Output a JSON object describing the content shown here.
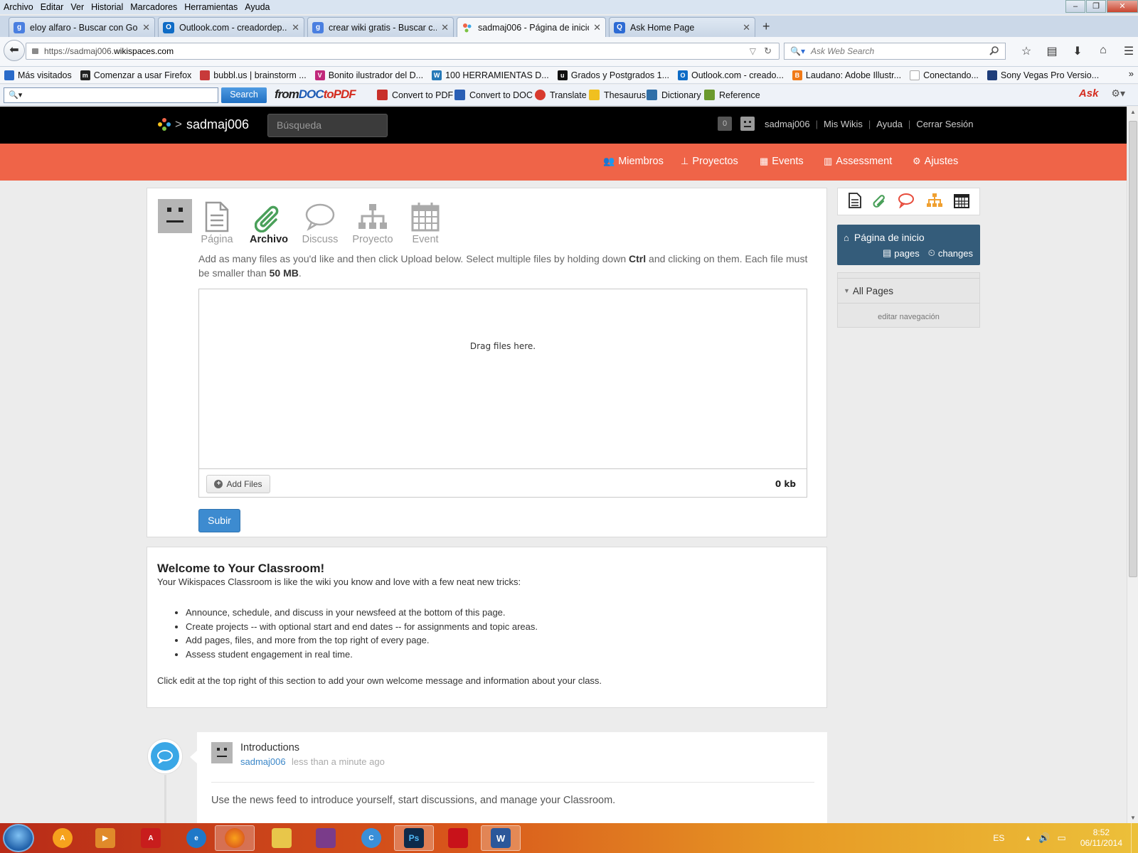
{
  "menubar": {
    "items": [
      "Archivo",
      "Editar",
      "Ver",
      "Historial",
      "Marcadores",
      "Herramientas",
      "Ayuda"
    ]
  },
  "tabs": [
    {
      "title": "eloy alfaro - Buscar con Go...",
      "icon": "google-icon",
      "color": "#4a7fe0"
    },
    {
      "title": "Outlook.com - creadordep...",
      "icon": "outlook-icon",
      "color": "#0f6cc6"
    },
    {
      "title": "crear wiki gratis - Buscar c...",
      "icon": "google-icon",
      "color": "#4a7fe0"
    },
    {
      "title": "sadmaj006 - Página de inicio",
      "icon": "wikispaces-icon",
      "color": "#ffffff",
      "active": true
    },
    {
      "title": "Ask Home Page",
      "icon": "ask-search-icon",
      "color": "#2d6bd4"
    }
  ],
  "urlbar": {
    "prefix": "https://sadmaj006.",
    "domain": "wikispaces.com"
  },
  "searchbar": {
    "placeholder": "Ask Web Search"
  },
  "bookmarks": [
    {
      "label": "Más visitados",
      "color": "#2a6bc9"
    },
    {
      "label": "Comenzar a usar Firefox",
      "color": "#222222"
    },
    {
      "label": "bubbl.us | brainstorm ...",
      "color": "#c83a3a"
    },
    {
      "label": "Bonito ilustrador del D...",
      "color": "#c0287a"
    },
    {
      "label": "100 HERRAMIENTAS D...",
      "color": "#2679b8"
    },
    {
      "label": "Grados y Postgrados 1...",
      "color": "#111111"
    },
    {
      "label": "Outlook.com - creado...",
      "color": "#0f6cc6"
    },
    {
      "label": "Laudano: Adobe Illustr...",
      "color": "#f07a18"
    },
    {
      "label": "Conectando...",
      "color": "#cccccc"
    },
    {
      "label": "Sony Vegas Pro Versio...",
      "color": "#1f3e7a"
    }
  ],
  "asktoolbar": {
    "search_label": "Search",
    "logo_from": "from",
    "logo_doc": "DOC",
    "logo_to": "to",
    "logo_pdf": "PDF",
    "items": [
      "Convert to PDF",
      "Convert to DOC",
      "Translate",
      "Thesaurus",
      "Dictionary",
      "Reference"
    ],
    "brand": "Ask"
  },
  "wiki": {
    "name": "sadmaj006",
    "search_placeholder": "Búsqueda",
    "notif_count": "0",
    "user": "sadmaj006",
    "links": [
      "Mis Wikis",
      "Ayuda",
      "Cerrar Sesión"
    ],
    "nav": [
      "Miembros",
      "Proyectos",
      "Events",
      "Assessment",
      "Ajustes"
    ],
    "accent": "#ef6448"
  },
  "upload": {
    "tools": [
      "Página",
      "Archivo",
      "Discuss",
      "Proyecto",
      "Event"
    ],
    "desc_1": "Add as many files as you'd like and then click Upload below. Select multiple files by holding down ",
    "desc_ctrl": "Ctrl",
    "desc_2": " and clicking on them. Each file must be smaller than ",
    "desc_size": "50 MB",
    "desc_3": ".",
    "drop_text": "Drag files here.",
    "add_files": "Add Files",
    "total": "0 kb",
    "submit": "Subir"
  },
  "welcome": {
    "title": "Welcome to Your Classroom!",
    "intro": "Your Wikispaces Classroom is like the wiki you know and love with a few neat new tricks:",
    "bullets": [
      "Announce, schedule, and discuss in your newsfeed at the bottom of this page.",
      "Create projects -- with optional start and end dates -- for assignments and topic areas.",
      "Add pages, files, and more from the top right of every page.",
      "Assess student engagement in real time."
    ],
    "outro": "Click edit at the top right of this section to add your own welcome message and information about your class."
  },
  "feed": {
    "title": "Introductions",
    "user": "sadmaj006",
    "time": "less than a minute ago",
    "text": "Use the news feed to introduce yourself, start discussions, and manage your Classroom."
  },
  "sidebar": {
    "home": "Página de inicio",
    "pages": "pages",
    "changes": "changes",
    "all_pages": "All Pages",
    "edit_nav": "editar navegación"
  },
  "taskbar": {
    "lang": "ES",
    "time": "8:52",
    "date": "06/11/2014"
  }
}
